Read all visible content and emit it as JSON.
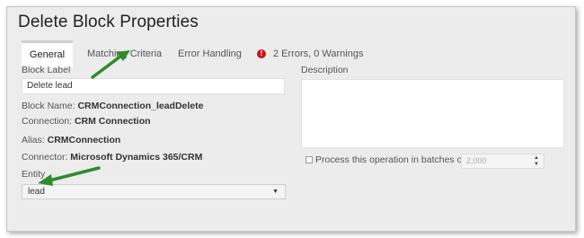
{
  "dialog": {
    "title": "Delete Block Properties"
  },
  "tabs": [
    {
      "label": "General",
      "active": true
    },
    {
      "label": "Matching Criteria",
      "active": false
    },
    {
      "label": "Error Handling",
      "active": false
    }
  ],
  "status": {
    "icon": "error-icon",
    "text": "2 Errors, 0 Warnings",
    "color": "#c8141e"
  },
  "left": {
    "block_label": {
      "label": "Block Label",
      "value": "Delete lead"
    },
    "block_name": {
      "label": "Block Name:",
      "value": "CRMConnection_leadDelete"
    },
    "connection": {
      "label": "Connection:",
      "value": "CRM Connection"
    },
    "alias": {
      "label": "Alias:",
      "value": "CRMConnection"
    },
    "connector": {
      "label": "Connector:",
      "value": "Microsoft Dynamics 365/CRM"
    },
    "entity": {
      "label": "Entity",
      "value": "lead"
    }
  },
  "right": {
    "description": {
      "label": "Description",
      "value": ""
    },
    "batch": {
      "label": "Process this operation in batches of",
      "checked": false,
      "value": "2,000"
    }
  },
  "annotation_color": "#2e8b2e"
}
